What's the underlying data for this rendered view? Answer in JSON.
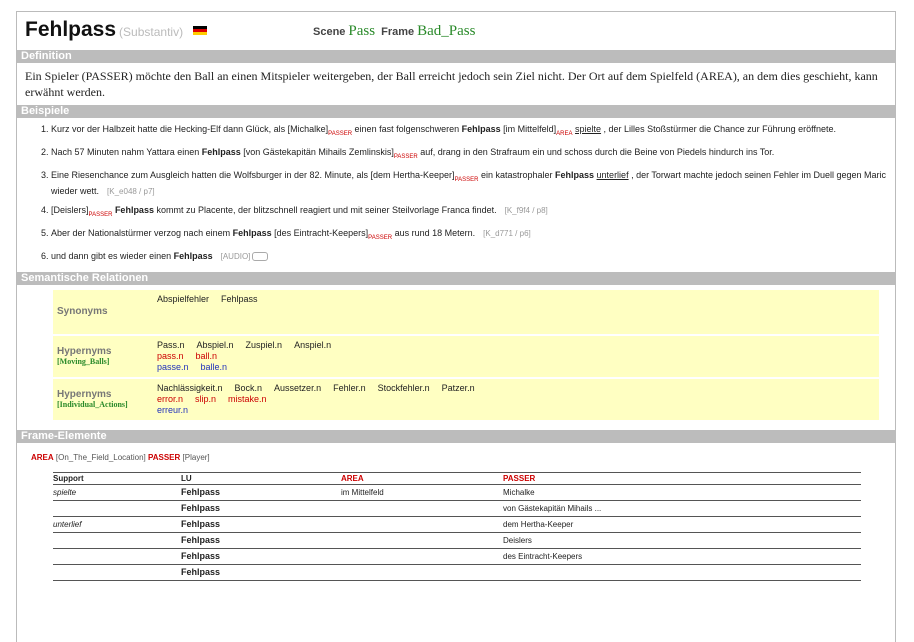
{
  "lexical_unit": {
    "word": "Fehlpass",
    "pos": "(Substantiv)",
    "flag": "german-flag-icon"
  },
  "scene": {
    "label": "Scene",
    "value": "Pass"
  },
  "frame": {
    "label": "Frame",
    "value": "Bad_Pass"
  },
  "sections": {
    "definition": "Definition",
    "examples": "Beispiele",
    "relations": "Semantische Relationen",
    "frame_elements": "Frame-Elemente"
  },
  "definition": "Ein Spieler (PASSER) möchte den Ball an einen Mitspieler weitergeben, der Ball erreicht jedoch sein Ziel nicht. Der Ort auf dem Spielfeld (AREA), an dem dies geschieht, kann erwähnt werden.",
  "examples": [
    {
      "p1": "Kurz vor der Halbzeit hatte die Hecking-Elf dann Glück, als ",
      "a": "[Michalke]",
      "at": "PASSER",
      "p2": " einen fast folgenschweren ",
      "t": "Fehlpass",
      "p3": " ",
      "b": "[im Mittelfeld]",
      "bt": "AREA",
      "p4": " ",
      "lu": "spielte",
      "p5": " , der Lilles Stoßstürmer die Chance zur Führung eröffnete.",
      "ref": ""
    },
    {
      "p1": "Nach 57 Minuten nahm Yattara einen ",
      "a": "",
      "at": "",
      "p2": "",
      "t": "Fehlpass",
      "p3": " [von Gästekapitän Mihails Zemlinskis]",
      "b": "",
      "bt": "PASSER",
      "p4": " auf, drang in den Strafraum ein und schoss durch die Beine von Piedels hindurch ins Tor.",
      "lu": "",
      "p5": "",
      "ref": ""
    },
    {
      "p1": "Eine Riesenchance zum Ausgleich hatten die Wolfsburger in der 82. Minute, als ",
      "a": "[dem Hertha-Keeper]",
      "at": "PASSER",
      "p2": " ein katastrophaler ",
      "t": "Fehlpass",
      "p3": " ",
      "b": "",
      "bt": "",
      "p4": "",
      "lu": "unterlief",
      "p5": " , der Torwart machte jedoch seinen Fehler im Duell gegen Maric wieder wett.",
      "ref": "[K_e048 / p7]"
    },
    {
      "p1": "",
      "a": "[Deislers]",
      "at": "PASSER",
      "p2": " ",
      "t": "Fehlpass",
      "p3": " kommt zu Placente, der blitzschnell reagiert und mit seiner Steilvorlage Franca findet.",
      "b": "",
      "bt": "",
      "p4": "",
      "lu": "",
      "p5": "",
      "ref": "[K_f9f4 / p8]"
    },
    {
      "p1": "Aber der Nationalstürmer verzog nach einem ",
      "a": "",
      "at": "",
      "p2": "",
      "t": "Fehlpass",
      "p3": " [des Eintracht-Keepers]",
      "b": "",
      "bt": "PASSER",
      "p4": " aus rund 18 Metern.",
      "lu": "",
      "p5": "",
      "ref": "[K_d771 / p6]"
    },
    {
      "p1": "und dann gibt es wieder einen ",
      "a": "",
      "at": "",
      "p2": "",
      "t": "Fehlpass",
      "p3": "",
      "b": "",
      "bt": "",
      "p4": "",
      "lu": "",
      "p5": "",
      "ref": "[AUDIO]"
    }
  ],
  "relations": [
    {
      "label": "Synonyms",
      "sub": "",
      "de": [
        "Abspielfehler",
        "Fehlpass"
      ],
      "en": [],
      "fr": []
    },
    {
      "label": "Hypernyms",
      "sub": "[Moving_Balls]",
      "de": [
        "Pass.n",
        "Abspiel.n",
        "Zuspiel.n",
        "Anspiel.n"
      ],
      "en": [
        "pass.n",
        "ball.n"
      ],
      "fr": [
        "passe.n",
        "balle.n"
      ]
    },
    {
      "label": "Hypernyms",
      "sub": "[Individual_Actions]",
      "de": [
        "Nachlässigkeit.n",
        "Bock.n",
        "Aussetzer.n",
        "Fehler.n",
        "Stockfehler.n",
        "Patzer.n"
      ],
      "en": [
        "error.n",
        "slip.n",
        "mistake.n"
      ],
      "fr": [
        "erreur.n"
      ]
    }
  ],
  "fe_legend": {
    "e1": "AREA",
    "d1": "[On_The_Field_Location]",
    "e2": "PASSER",
    "d2": "[Player]"
  },
  "table": {
    "headers": [
      "Support",
      "LU",
      "AREA",
      "PASSER"
    ],
    "rows": [
      [
        "spielte",
        "Fehlpass",
        "im Mittelfeld",
        "Michalke"
      ],
      [
        "",
        "Fehlpass",
        "",
        "von Gästekapitän Mihails ..."
      ],
      [
        "unterlief",
        "Fehlpass",
        "",
        "dem Hertha-Keeper"
      ],
      [
        "",
        "Fehlpass",
        "",
        "Deislers"
      ],
      [
        "",
        "Fehlpass",
        "",
        "des Eintracht-Keepers"
      ],
      [
        "",
        "Fehlpass",
        "",
        ""
      ]
    ]
  },
  "colors": {
    "section_bar": "#bcbcbc",
    "relation_bg": "#ffffc2",
    "frame_green": "#2a8a2a",
    "element_red": "#cc0000"
  }
}
